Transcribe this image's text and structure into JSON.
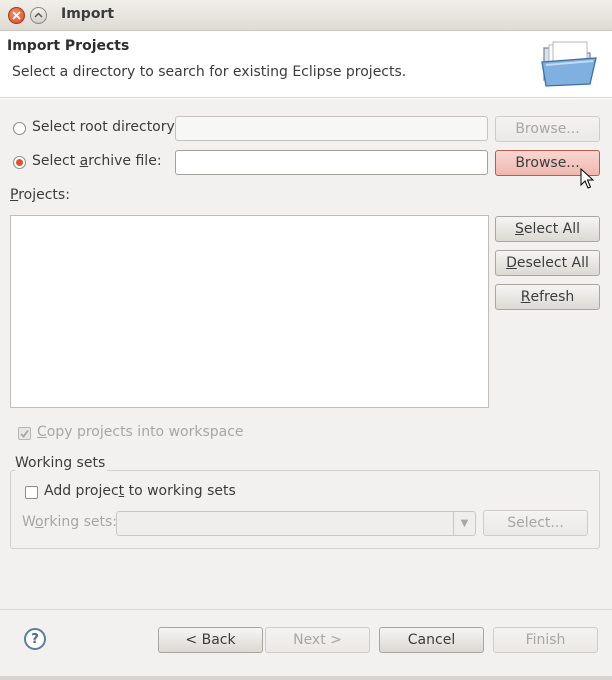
{
  "window": {
    "title": "Import"
  },
  "header": {
    "title": "Import Projects",
    "description": "Select a directory to search for existing Eclipse projects."
  },
  "source": {
    "root_directory": {
      "label": "Select root directory:",
      "value": "",
      "selected": false,
      "browse_label": "Browse...",
      "enabled": false
    },
    "archive_file": {
      "label_pre": "Select ",
      "label_mnemonic": "a",
      "label_post": "rchive file:",
      "value": "",
      "selected": true,
      "browse_label": "Browse...",
      "enabled": true
    }
  },
  "projects": {
    "label_mnemonic": "P",
    "label_rest": "rojects:",
    "items": [],
    "select_all": {
      "mnemonic": "S",
      "rest": "elect All"
    },
    "deselect_all": {
      "mnemonic": "D",
      "rest": "eselect All"
    },
    "refresh": {
      "mnemonic": "R",
      "rest": "efresh"
    }
  },
  "copy_into_workspace": {
    "mnemonic": "C",
    "rest": "opy projects into workspace",
    "checked": true,
    "enabled": false
  },
  "working_sets": {
    "group_title": "Working sets",
    "add_to_working_sets": {
      "pre": "Add projec",
      "mnemonic": "t",
      "post": " to working sets",
      "checked": false
    },
    "field_label_pre": "W",
    "field_label_mnemonic": "o",
    "field_label_post": "rking sets:",
    "value": "",
    "select_button": "Select..."
  },
  "footer": {
    "back": "< Back",
    "next": "Next >",
    "cancel": "Cancel",
    "finish": "Finish"
  },
  "colors": {
    "accent": "#e0502a",
    "focused_button": "#efb7ae",
    "disabled_text": "#a8a6a2"
  }
}
